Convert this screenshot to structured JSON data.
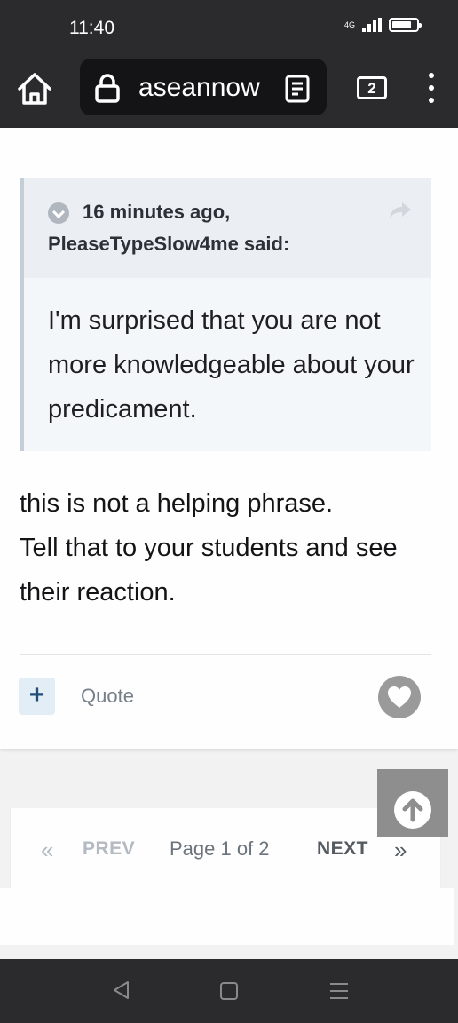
{
  "status_bar": {
    "time": "11:40",
    "network": "4G"
  },
  "browser": {
    "url": "aseannow",
    "tab_count": "2"
  },
  "quote": {
    "time": "16 minutes ago,",
    "author": "PleaseTypeSlow4me said:",
    "text": "I'm surprised that you are not more knowledgeable about your predicament."
  },
  "post": {
    "text": "this is not a helping phrase.\n Tell that to your students and see their reaction."
  },
  "actions": {
    "add_label": "+",
    "quote_label": "Quote"
  },
  "pagination": {
    "first": "«",
    "prev": "PREV",
    "info": "Page 1 of 2",
    "next": "NEXT",
    "last": "»"
  }
}
